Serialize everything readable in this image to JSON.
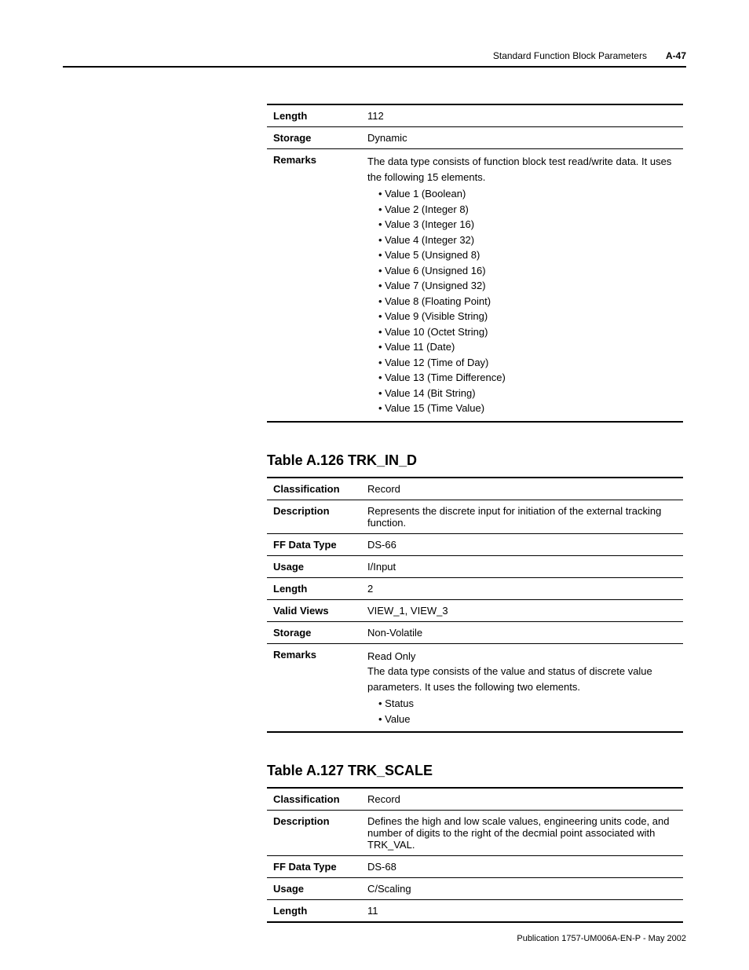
{
  "header": {
    "running_title": "Standard Function Block Parameters",
    "page_num": "A-47"
  },
  "table1": {
    "rows": {
      "length": {
        "key": "Length",
        "val": "112"
      },
      "storage": {
        "key": "Storage",
        "val": "Dynamic"
      },
      "remarks": {
        "key": "Remarks",
        "intro": "The data type consists of function block test read/write data. It uses the following 15 elements.",
        "items": [
          "Value 1 (Boolean)",
          "Value 2 (Integer 8)",
          "Value 3 (Integer 16)",
          "Value 4 (Integer 32)",
          "Value 5 (Unsigned 8)",
          "Value 6 (Unsigned 16)",
          "Value 7 (Unsigned 32)",
          "Value 8 (Floating Point)",
          "Value 9 (Visible String)",
          "Value 10 (Octet String)",
          "Value 11 (Date)",
          "Value 12 (Time of Day)",
          "Value 13 (Time Difference)",
          "Value 14 (Bit String)",
          "Value 15 (Time Value)"
        ]
      }
    }
  },
  "table2": {
    "title": "Table A.126 TRK_IN_D",
    "rows": {
      "classification": {
        "key": "Classification",
        "val": "Record"
      },
      "description": {
        "key": "Description",
        "val": "Represents the discrete input for initiation of the external tracking function."
      },
      "ffdatatype": {
        "key": "FF Data Type",
        "val": "DS-66"
      },
      "usage": {
        "key": "Usage",
        "val": "I/Input"
      },
      "length": {
        "key": "Length",
        "val": "2"
      },
      "validviews": {
        "key": "Valid Views",
        "val": "VIEW_1, VIEW_3"
      },
      "storage": {
        "key": "Storage",
        "val": "Non-Volatile"
      },
      "remarks": {
        "key": "Remarks",
        "intro1": "Read Only",
        "intro2": "The data type consists of the value and status of discrete value parameters. It uses the following two elements.",
        "items": [
          "Status",
          "Value"
        ]
      }
    }
  },
  "table3": {
    "title": "Table A.127 TRK_SCALE",
    "rows": {
      "classification": {
        "key": "Classification",
        "val": "Record"
      },
      "description": {
        "key": "Description",
        "val": "Defines the high and low scale values, engineering units code, and number of digits to the right of the decmial point associated with TRK_VAL."
      },
      "ffdatatype": {
        "key": "FF Data Type",
        "val": "DS-68"
      },
      "usage": {
        "key": "Usage",
        "val": "C/Scaling"
      },
      "length": {
        "key": "Length",
        "val": "11"
      }
    }
  },
  "footer": {
    "text": "Publication 1757-UM006A-EN-P - May 2002"
  }
}
